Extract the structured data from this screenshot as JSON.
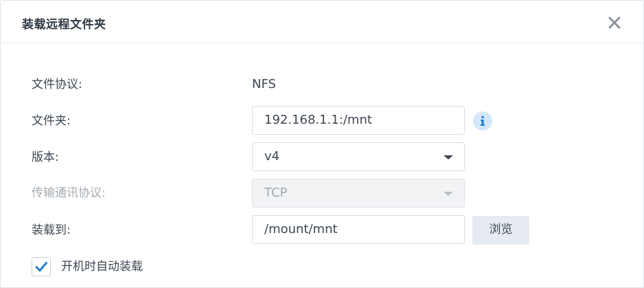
{
  "dialog": {
    "title": "装载远程文件夹",
    "close_icon": "close-icon"
  },
  "form": {
    "protocol": {
      "label": "文件协议:",
      "value": "NFS"
    },
    "folder": {
      "label": "文件夹:",
      "value": "192.168.1.1:/mnt",
      "info_icon": "info-icon"
    },
    "version": {
      "label": "版本:",
      "selected": "v4",
      "icon": "chevron-down-icon"
    },
    "transport": {
      "label": "传输通讯协议:",
      "selected": "TCP",
      "disabled": true,
      "icon": "chevron-down-icon"
    },
    "mount_to": {
      "label": "装载到:",
      "value": "/mount/mnt",
      "browse_label": "浏览"
    },
    "auto_mount": {
      "label": "开机时自动装载",
      "checked": true,
      "icon": "checkmark-icon"
    }
  },
  "colors": {
    "accent": "#1c7ed6",
    "info_bg": "#d5e8fb",
    "button_bg": "#e6ebf1",
    "disabled_text": "#a3aab1"
  }
}
